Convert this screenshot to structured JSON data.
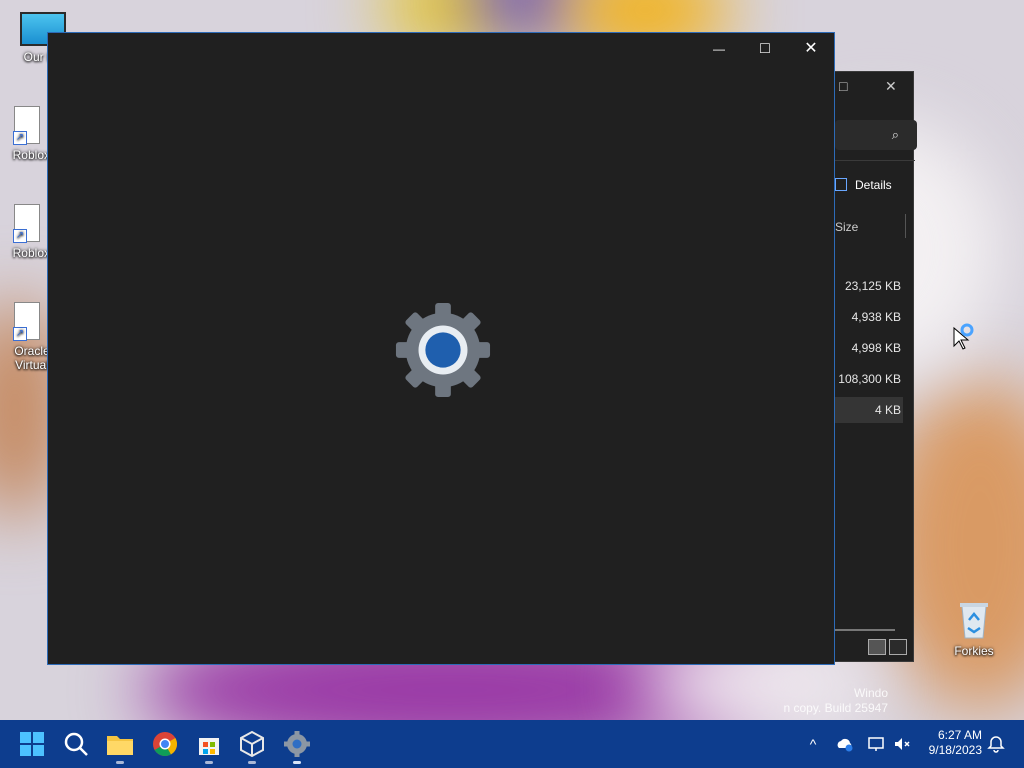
{
  "desktop": {
    "icons": [
      {
        "label": "Our F"
      },
      {
        "label": "Roblox S"
      },
      {
        "label": "Roblox P"
      },
      {
        "label": "Oracle Virtual"
      },
      {
        "label": "Forkies"
      }
    ],
    "watermark": [
      "Windo",
      "n copy. Build 25947"
    ]
  },
  "explorer": {
    "maximize_icon": "□",
    "close_icon": "✕",
    "search_icon": "⌕",
    "details_label": "Details",
    "column_header": "Size",
    "rows": [
      "23,125 KB",
      "4,938 KB",
      "4,998 KB",
      "108,300 KB",
      "4 KB"
    ]
  },
  "settings_window": {
    "minimize_icon": "—",
    "maximize_icon": "□",
    "close_icon": "✕",
    "colors": {
      "gear": "#6e7680",
      "accent": "#1f5fae"
    }
  },
  "taskbar": {
    "apps": [
      "start-icon",
      "search-icon",
      "file-explorer-icon",
      "chrome-icon",
      "store-icon",
      "virtualbox-icon",
      "settings-icon"
    ],
    "tray": {
      "chevron": "^",
      "time": "6:27 AM",
      "date": "9/18/2023"
    }
  }
}
